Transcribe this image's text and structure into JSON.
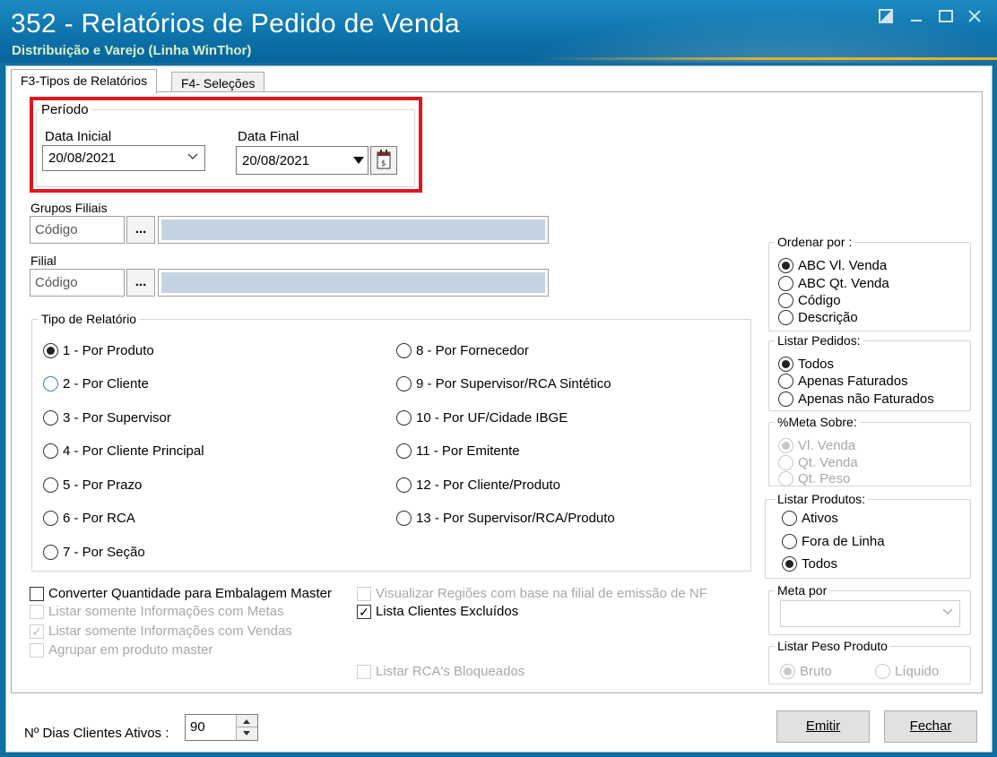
{
  "window": {
    "title": "352 - Relatórios de Pedido de Venda",
    "subtitle": "Distribuição e Varejo (Linha WinThor)",
    "controls": [
      "restore",
      "minimize",
      "maximize",
      "close"
    ]
  },
  "tabs": [
    {
      "label": "F3-Tipos de Relatórios",
      "active": true
    },
    {
      "label": "F4- Seleções",
      "active": false
    }
  ],
  "periodo": {
    "label": "Período",
    "data_inicial_label": "Data Inicial",
    "data_inicial": "20/08/2021",
    "data_final_label": "Data Final",
    "data_final": "20/08/2021"
  },
  "grupos_filiais": {
    "label": "Grupos Filiais",
    "placeholder": "Código",
    "dots": "..."
  },
  "filial": {
    "label": "Filial",
    "placeholder": "Código",
    "dots": "..."
  },
  "tipo_relatorio": {
    "label": "Tipo de Relatório",
    "options": [
      "1 - Por Produto",
      "2 - Por Cliente",
      "3 - Por Supervisor",
      "4 - Por Cliente Principal",
      "5 - Por Prazo",
      "6 - Por RCA",
      "7 - Por Seção",
      "8 - Por Fornecedor",
      "9 - Por Supervisor/RCA Sintético",
      "10 - Por UF/Cidade IBGE",
      "11 - Por Emitente",
      "12 - Por Cliente/Produto",
      "13 - Por Supervisor/RCA/Produto"
    ],
    "selected": "1 - Por Produto"
  },
  "checks": {
    "converter": "Converter Quantidade para Embalagem Master",
    "metas": "Listar somente Informações com Metas",
    "vendas": "Listar somente Informações com Vendas",
    "agrupar": "Agrupar em produto master",
    "regioes": "Visualizar Regiões com base na filial de emissão de NF",
    "excluidos": "Lista Clientes Excluídos",
    "rca_bloqueados": "Listar RCA's Bloqueados"
  },
  "ordenar": {
    "label": "Ordenar por :",
    "options": [
      "ABC Vl. Venda",
      "ABC Qt. Venda",
      "Código",
      "Descrição"
    ],
    "selected": "ABC Vl. Venda"
  },
  "listar_pedidos": {
    "label": "Listar Pedidos:",
    "options": [
      "Todos",
      "Apenas Faturados",
      "Apenas não Faturados"
    ],
    "selected": "Todos"
  },
  "meta_sobre": {
    "label": "%Meta Sobre:",
    "options": [
      "Vl. Venda",
      "Qt. Venda",
      "Qt. Peso"
    ],
    "selected": "Vl. Venda"
  },
  "listar_produtos": {
    "label": "Listar Produtos:",
    "options": [
      "Ativos",
      "Fora de Linha",
      "Todos"
    ],
    "selected": "Todos"
  },
  "meta_por": {
    "label": "Meta por",
    "value": ""
  },
  "peso": {
    "label": "Listar Peso Produto",
    "options": [
      "Bruto",
      "Líquido"
    ],
    "selected": "Bruto"
  },
  "footer": {
    "dias_label": "Nº Dias Clientes Ativos :",
    "dias_value": "90",
    "emitir": "Emitir",
    "fechar": "Fechar"
  }
}
